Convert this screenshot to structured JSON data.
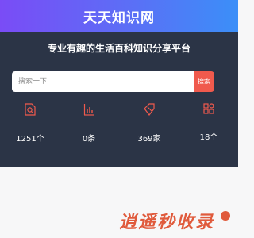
{
  "header": {
    "logo": "天天知识网"
  },
  "hero": {
    "tagline": "专业有趣的生活百科知识分享平台",
    "search": {
      "placeholder": "搜索一下",
      "button_label": "搜索"
    },
    "stats": [
      {
        "icon": "document-search-icon",
        "value": "1251个"
      },
      {
        "icon": "bar-chart-icon",
        "value": "0条"
      },
      {
        "icon": "tag-icon",
        "value": "369家"
      },
      {
        "icon": "grid-icon",
        "value": "18个"
      }
    ]
  },
  "watermark": {
    "text": "逍遥秒收录"
  },
  "colors": {
    "accent": "#f05a4d",
    "hero_bg": "#2b3446",
    "header_start": "#7a4cf6",
    "header_end": "#3b8ff8"
  }
}
